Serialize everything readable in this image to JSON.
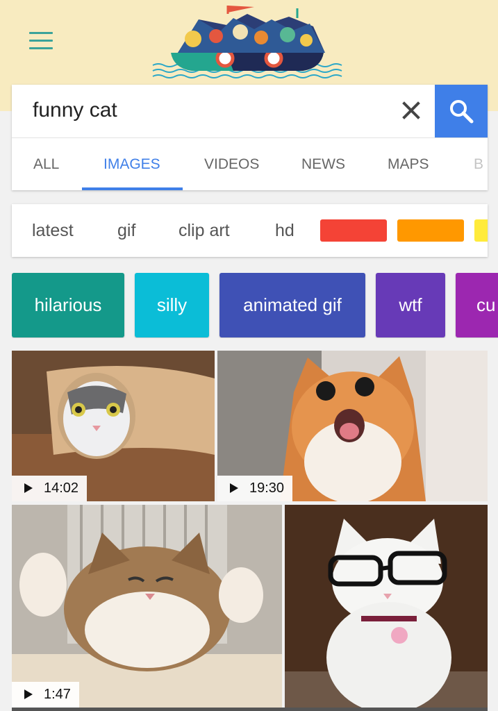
{
  "header": {
    "menu_icon": "hamburger-menu-icon",
    "logo_icon": "google-doodle-boat-icon"
  },
  "search": {
    "query": "funny cat",
    "clear_icon": "close-icon",
    "search_icon": "search-icon"
  },
  "tabs": [
    {
      "label": "ALL"
    },
    {
      "label": "IMAGES",
      "active": true
    },
    {
      "label": "VIDEOS"
    },
    {
      "label": "NEWS"
    },
    {
      "label": "MAPS"
    },
    {
      "label": "B"
    }
  ],
  "filters": {
    "items": [
      {
        "label": "latest"
      },
      {
        "label": "gif"
      },
      {
        "label": "clip art"
      },
      {
        "label": "hd"
      }
    ],
    "colors": [
      "#f44336",
      "#ff9800",
      "#ffeb3b"
    ]
  },
  "chips": [
    {
      "label": "hilarious",
      "color": "#14998a"
    },
    {
      "label": "silly",
      "color": "#0bbdd7"
    },
    {
      "label": "animated gif",
      "color": "#3f51b5"
    },
    {
      "label": "wtf",
      "color": "#673ab7"
    },
    {
      "label": "cu",
      "color": "#9c27b0"
    }
  ],
  "results": [
    {
      "duration": "14:02"
    },
    {
      "duration": "19:30"
    },
    {
      "duration": "1:47"
    },
    {
      "duration": ""
    }
  ],
  "accent": "#3f7fe8"
}
